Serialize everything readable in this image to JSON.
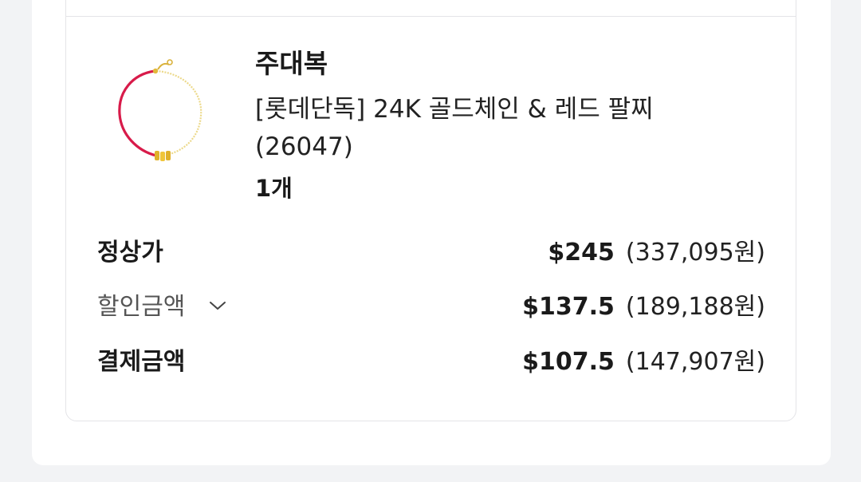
{
  "order_item": {
    "brand": "주대복",
    "product_name": "[롯데단독] 24K 골드체인 & 레드 팔찌 (26047)",
    "quantity": "1개",
    "image_icon": "gold-red-bracelet-image"
  },
  "price_summary": {
    "regular_price": {
      "label": "정상가",
      "usd": "$245",
      "krw": "(337,095원)"
    },
    "discount": {
      "label": "할인금액",
      "usd": "$137.5",
      "krw": "(189,188원)",
      "toggle_icon": "chevron-down-icon"
    },
    "payment": {
      "label": "결제금액",
      "usd": "$107.5",
      "krw": "(147,907원)"
    }
  },
  "colors": {
    "background": "#f2f3f5",
    "card": "#ffffff",
    "border": "#e4e4e7",
    "text": "#1a1a1a",
    "bracelet_red": "#d81b4a",
    "bracelet_gold": "#e8c84a"
  }
}
